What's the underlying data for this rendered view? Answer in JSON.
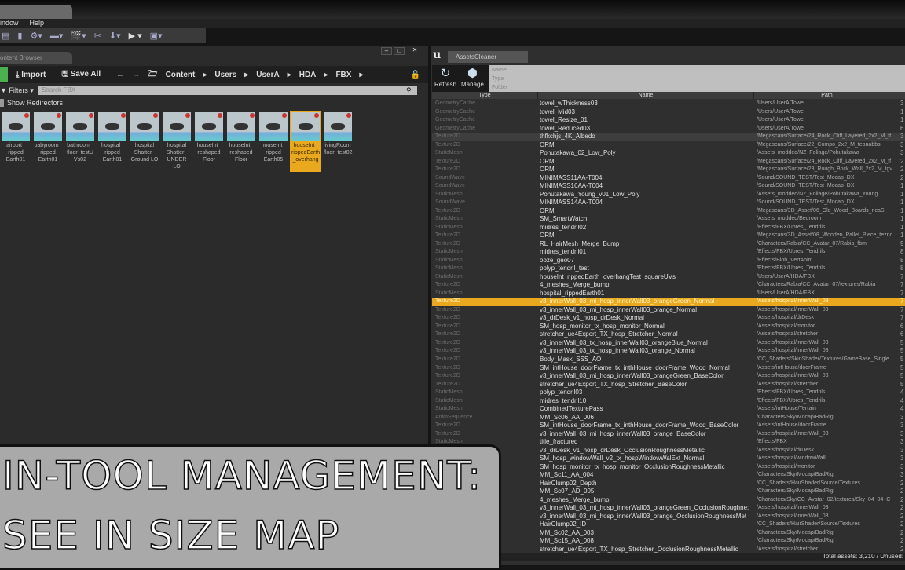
{
  "menu": [
    "indow",
    "Help"
  ],
  "content_browser": {
    "tab": "ontent Browser",
    "import": "Import",
    "save_all": "Save All",
    "breadcrumb": [
      "Content",
      "Users",
      "UserA",
      "HDA",
      "FBX"
    ],
    "filters": "Filters",
    "search_placeholder": "Search FBX",
    "show_redirectors": "Show Redirectors",
    "assets": [
      {
        "label": "airport_ ripped Earth01"
      },
      {
        "label": "babyroom_ ripped Earth01"
      },
      {
        "label": "bathroom_ floor_testU Vs02"
      },
      {
        "label": "hospital_ ripped Earth01"
      },
      {
        "label": "hospital Shatter_ Ground LO"
      },
      {
        "label": "hospital Shatter_ UNDER LO"
      },
      {
        "label": "houseInt_ reshaped Floor"
      },
      {
        "label": "houseInt_ reshaped Floor"
      },
      {
        "label": "houseInt_ ripped Earth05"
      },
      {
        "label": "houseInt_ rippedEarth _overhang",
        "selected": true
      },
      {
        "label": "livingRoom_ floor_test02"
      }
    ]
  },
  "assets_cleaner": {
    "tab": "AssetsCleaner",
    "refresh": "Refresh",
    "manage": "Manage",
    "filters": [
      "Name",
      "Type",
      "Folder"
    ],
    "columns": [
      "Type",
      "Name",
      "Path"
    ],
    "status": "Total assets: 3,210 / Unused:",
    "highlight_color": "#e9a81d",
    "rows": [
      {
        "t": "GeometryCache",
        "n": "towel_wThickness03",
        "p": "/Users/UserA/Towel",
        "s": "3"
      },
      {
        "t": "GeometryCache",
        "n": "towel_Mid03",
        "p": "/Users/UserA/Towel",
        "s": "1"
      },
      {
        "t": "GeometryCache",
        "n": "towel_Resize_01",
        "p": "/Users/UserA/Towel",
        "s": "1"
      },
      {
        "t": "GeometryCache",
        "n": "towel_Reduced03",
        "p": "/Users/UserA/Towel",
        "s": "6"
      },
      {
        "t": "Texture2D",
        "n": "thfkchjs_4K_Albedo",
        "p": "/Megascans/Surface/24_Rock_Cliff_Layered_2x2_M_tf",
        "s": "3"
      },
      {
        "t": "Texture2D",
        "n": "ORM",
        "p": "/Megascans/Surface/22_Compo_2x2_M_tepnabbs",
        "s": "3"
      },
      {
        "t": "StaticMesh",
        "n": "Pohutakawa_02_Low_Poly",
        "p": "/Assets_modded/NZ_Foliage/Pohutakawa",
        "s": "3"
      },
      {
        "t": "Texture2D",
        "n": "ORM",
        "p": "/Megascans/Surface/24_Rock_Cliff_Layered_2x2_M_tf",
        "s": "2"
      },
      {
        "t": "Texture2D",
        "n": "ORM",
        "p": "/Megascans/Surface/23_Rough_Brick_Wall_2x2_M_tgv",
        "s": "2"
      },
      {
        "t": "SoundWave",
        "n": "MINIMASS11AA-T004",
        "p": "/Sound/SOUND_TEST/Test_Mocap_DX",
        "s": "2"
      },
      {
        "t": "SoundWave",
        "n": "MINIMASS16AA-T004",
        "p": "/Sound/SOUND_TEST/Test_Mocap_DX",
        "s": "1"
      },
      {
        "t": "StaticMesh",
        "n": "Pohutakawa_Young_v01_Low_Poly",
        "p": "/Assets_modded/NZ_Foliage/Pohutakawa_Young",
        "s": "1"
      },
      {
        "t": "SoundWave",
        "n": "MINIMASS14AA-T004",
        "p": "/Sound/SOUND_TEST/Test_Mocap_DX",
        "s": "1"
      },
      {
        "t": "Texture2D",
        "n": "ORM",
        "p": "/Megascans/3D_Asset/06_Old_Wood_Boards_ricaS",
        "s": "1"
      },
      {
        "t": "StaticMesh",
        "n": "SM_SmartWatch",
        "p": "/Assets_modded/Bedroom",
        "s": "1"
      },
      {
        "t": "StaticMesh",
        "n": "midres_tendril02",
        "p": "/Effects/FBX/Upres_Tendrils",
        "s": "1"
      },
      {
        "t": "Texture2D",
        "n": "ORM",
        "p": "/Megascans/3D_Asset/08_Wooden_Pallet_Piece_teznc",
        "s": "1"
      },
      {
        "t": "Texture2D",
        "n": "RL_HairMesh_Merge_Bump",
        "p": "/Characters/Rabia/CC_Avatar_07/Rabia_fbm",
        "s": "9"
      },
      {
        "t": "StaticMesh",
        "n": "midres_tendril01",
        "p": "/Effects/FBX/Upres_Tendrils",
        "s": "8"
      },
      {
        "t": "StaticMesh",
        "n": "ooze_geo07",
        "p": "/Effects/Blob_VertAnim",
        "s": "8"
      },
      {
        "t": "StaticMesh",
        "n": "polyp_tendril_test",
        "p": "/Effects/FBX/Upres_Tendrils",
        "s": "8"
      },
      {
        "t": "StaticMesh",
        "n": "houseInt_rippedEarth_overhangTest_squareUVs",
        "p": "/Users/UserA/HDA/FBX",
        "s": "7"
      },
      {
        "t": "Texture2D",
        "n": "4_meshes_Merge_bump",
        "p": "/Characters/Rabia/CC_Avatar_07/textures/Rabia",
        "s": "7"
      },
      {
        "t": "StaticMesh",
        "n": "hospital_rippedEarth01",
        "p": "/Users/UserA/HDA/FBX",
        "s": "7"
      },
      {
        "t": "Texture2D",
        "n": "v3_innerWall_03_mi_hosp_innerWall03_orangeGreen_Normal",
        "p": "/Assets/hospital/innerWall_03",
        "s": "7",
        "hl": true
      },
      {
        "t": "Texture2D",
        "n": "v3_innerWall_03_mi_hosp_innerWall03_orange_Normal",
        "p": "/Assets/hospital/innerWall_03",
        "s": "7"
      },
      {
        "t": "Texture2D",
        "n": "v3_drDesk_v1_hosp_drDesk_Normal",
        "p": "/Assets/hospital/drDesk",
        "s": "7"
      },
      {
        "t": "Texture2D",
        "n": "SM_hosp_monitor_tx_hosp_monitor_Normal",
        "p": "/Assets/hospital/monitor",
        "s": "6"
      },
      {
        "t": "Texture2D",
        "n": "stretcher_ue4Export_TX_hosp_Stretcher_Normal",
        "p": "/Assets/hospital/stretcher",
        "s": "6"
      },
      {
        "t": "Texture2D",
        "n": "v3_innerWall_03_tx_hosp_innerWall03_orangeBlue_Normal",
        "p": "/Assets/hospital/innerWall_03",
        "s": "5"
      },
      {
        "t": "Texture2D",
        "n": "v3_innerWall_03_tx_hosp_innerWall03_orange_Normal",
        "p": "/Assets/hospital/innerWall_03",
        "s": "5"
      },
      {
        "t": "Texture2D",
        "n": "Body_Mask_SSS_AO",
        "p": "/CC_Shaders/SkinShader/Textures/GameBase_Single",
        "s": "5"
      },
      {
        "t": "Texture2D",
        "n": "SM_intHouse_doorFrame_tx_inthHouse_doorFrame_Wood_Normal",
        "p": "/Assets/intHouse/doorFrame",
        "s": "5"
      },
      {
        "t": "Texture2D",
        "n": "v3_innerWall_03_mi_hosp_innerWall03_orangeGreen_BaseColor",
        "p": "/Assets/hospital/innerWall_03",
        "s": "5"
      },
      {
        "t": "Texture2D",
        "n": "stretcher_ue4Export_TX_hosp_Stretcher_BaseColor",
        "p": "/Assets/hospital/stretcher",
        "s": "5"
      },
      {
        "t": "StaticMesh",
        "n": "polyp_tendril03",
        "p": "/Effects/FBX/Upres_Tendrils",
        "s": "4"
      },
      {
        "t": "StaticMesh",
        "n": "midres_tendril10",
        "p": "/Effects/FBX/Upres_Tendrils",
        "s": "4"
      },
      {
        "t": "StaticMesh",
        "n": "CombinedTexturePass",
        "p": "/Assets/intHouse/Terrain",
        "s": "4"
      },
      {
        "t": "AnimSequence",
        "n": "MM_Sc06_AA_006",
        "p": "/Characters/Sky/Mocap/BadRig",
        "s": "3"
      },
      {
        "t": "Texture2D",
        "n": "SM_intHouse_doorFrame_tx_inthHouse_doorFrame_Wood_BaseColor",
        "p": "/Assets/intHouse/doorFrame",
        "s": "3"
      },
      {
        "t": "Texture2D",
        "n": "v3_innerWall_03_mi_hosp_innerWall03_orange_BaseColor",
        "p": "/Assets/hospital/innerWall_03",
        "s": "3"
      },
      {
        "t": "StaticMesh",
        "n": "title_fractured",
        "p": "/Effects/FBX",
        "s": "3"
      },
      {
        "t": "",
        "n": "v3_drDesk_v1_hosp_drDesk_OcclusionRoughnessMetallic",
        "p": "/Assets/hospital/drDesk",
        "s": "3"
      },
      {
        "t": "",
        "n": "SM_hosp_windowWall_v2_tx_hospWindowWalExt_Normal",
        "p": "/Assets/hospital/windowWall",
        "s": "3"
      },
      {
        "t": "",
        "n": "SM_hosp_monitor_tx_hosp_monitor_OcclusionRoughnessMetallic",
        "p": "/Assets/hospital/monitor",
        "s": "3"
      },
      {
        "t": "",
        "n": "MM_Sc11_AA_004",
        "p": "/Characters/Sky/Mocap/BadRig",
        "s": "3"
      },
      {
        "t": "",
        "n": "HairClump02_Depth",
        "p": "/CC_Shaders/HairShader/Source/Textures",
        "s": "2"
      },
      {
        "t": "",
        "n": "MM_Sc07_AD_005",
        "p": "/Characters/Sky/Mocap/BadRig",
        "s": "2"
      },
      {
        "t": "",
        "n": "4_meshes_Merge_bump",
        "p": "/Characters/Sky/CC_Avatar_02/textures/Sky_04_04_C",
        "s": "2"
      },
      {
        "t": "",
        "n": "v3_innerWall_03_mi_hosp_innerWall03_orangeGreen_OcclusionRoughne:",
        "p": "/Assets/hospital/innerWall_03",
        "s": "2"
      },
      {
        "t": "",
        "n": "v3_innerWall_03_mi_hosp_innerWall03_orange_OcclusionRoughnessMet",
        "p": "/Assets/hospital/innerWall_03",
        "s": "2"
      },
      {
        "t": "",
        "n": "HairClump02_ID",
        "p": "/CC_Shaders/HairShader/Source/Textures",
        "s": "2"
      },
      {
        "t": "",
        "n": "MM_Sc02_AA_003",
        "p": "/Characters/Sky/Mocap/BadRig",
        "s": "2"
      },
      {
        "t": "",
        "n": "MM_Sc15_AA_008",
        "p": "/Characters/Sky/Mocap/BadRig",
        "s": "2"
      },
      {
        "t": "",
        "n": "stretcher_ue4Export_TX_hosp_Stretcher_OcclusionRoughnessMetallic",
        "p": "/Assets/hospital/stretcher",
        "s": "2"
      }
    ]
  },
  "overlay": {
    "line1": "IN-TOOL MANAGEMENT:",
    "line2": "SEE IN SIZE MAP"
  }
}
